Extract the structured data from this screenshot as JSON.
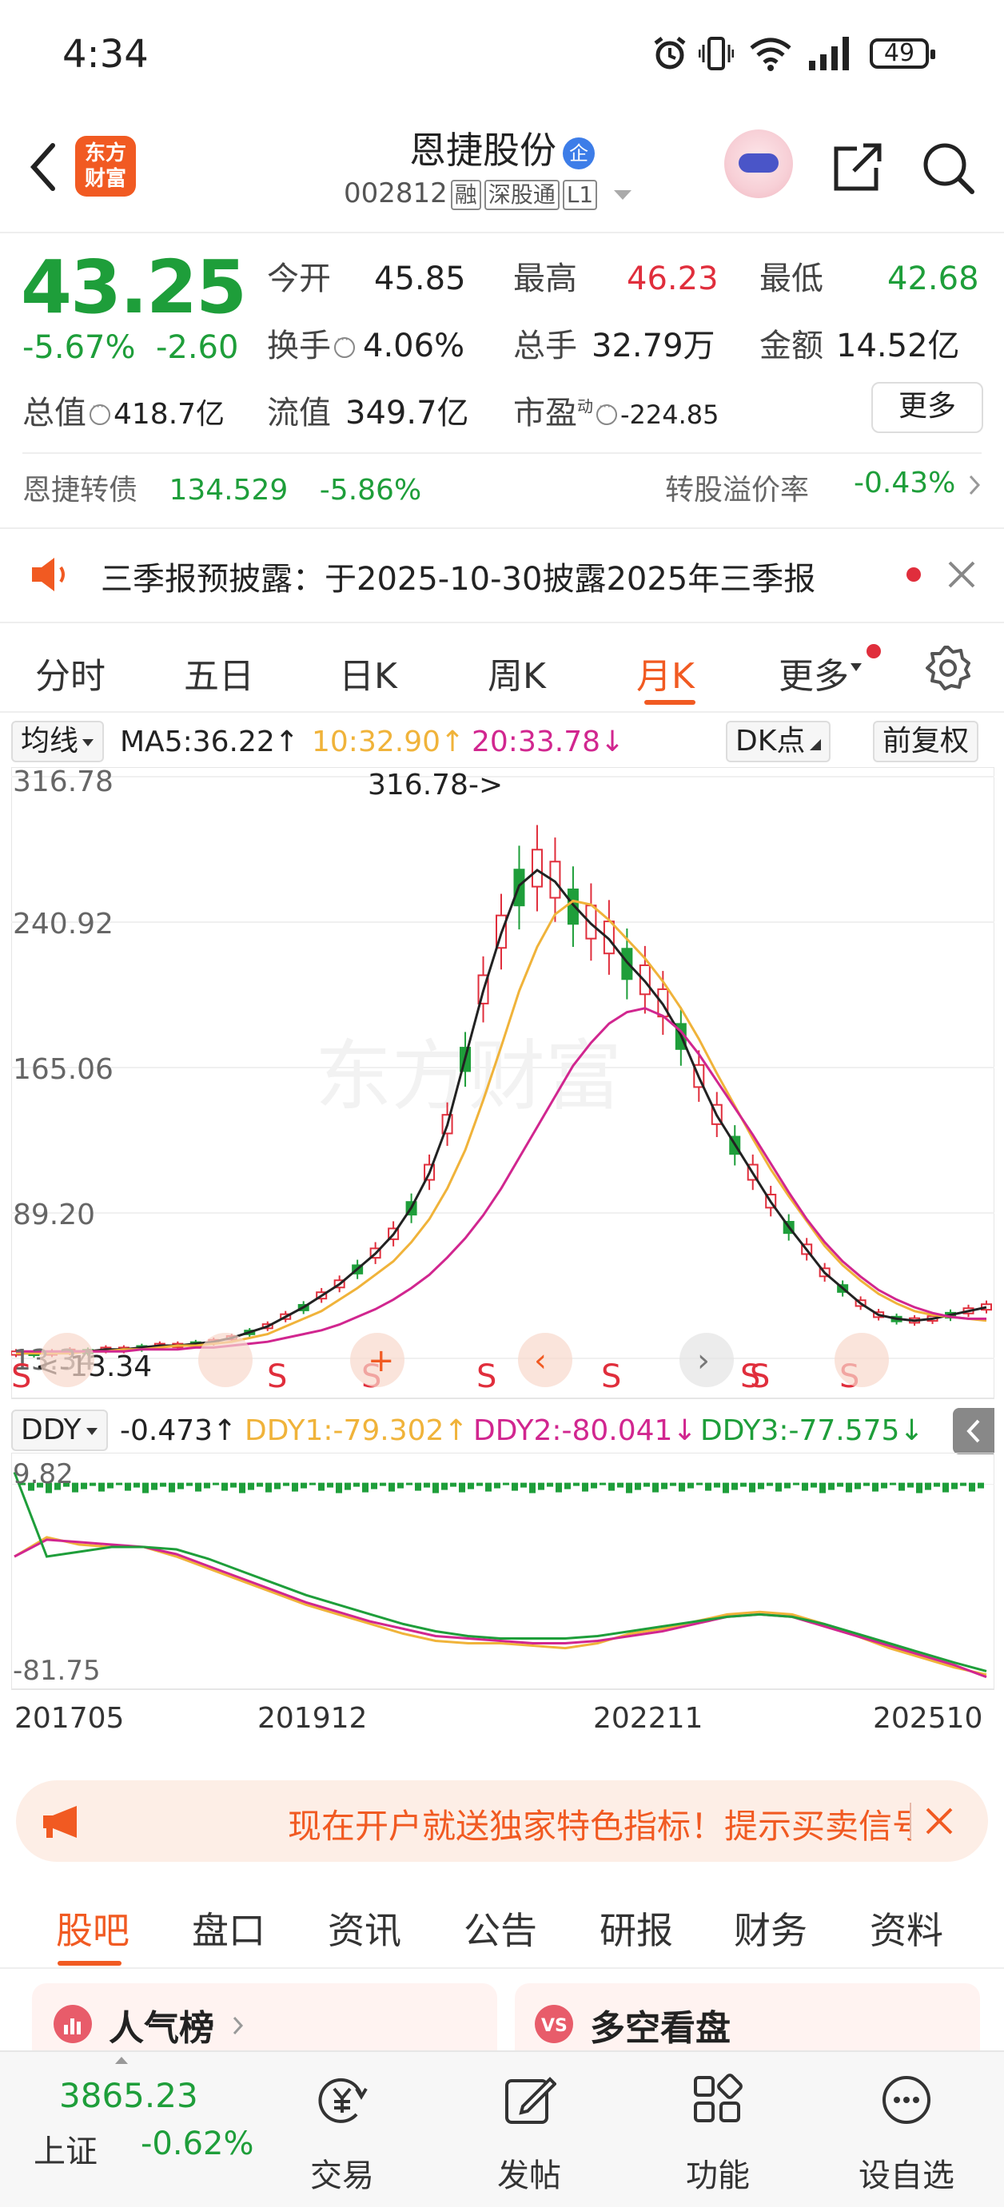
{
  "status_bar": {
    "time": "4:34",
    "battery": "49"
  },
  "header": {
    "logo_line1": "东方",
    "logo_line2": "财富",
    "stock_name": "恩捷股份",
    "badge": "企",
    "stock_code": "002812",
    "tags": [
      "融",
      "深股通",
      "L1"
    ]
  },
  "quote": {
    "price": "43.25",
    "change_pct": "-5.67%",
    "change_amt": "-2.60",
    "open_label": "今开",
    "open": "45.85",
    "high_label": "最高",
    "high": "46.23",
    "low_label": "最低",
    "low": "42.68",
    "turnover_label": "换手",
    "turnover": "4.06%",
    "volume_label": "总手",
    "volume": "32.79万",
    "amount_label": "金额",
    "amount": "14.52亿",
    "mktcap_label": "总值",
    "mktcap": "418.7亿",
    "float_label": "流值",
    "float": "349.7亿",
    "pe_label": "市盈",
    "pe_sup": "动",
    "pe": "-224.85",
    "more_label": "更多"
  },
  "bond": {
    "name": "恩捷转债",
    "price": "134.529",
    "change": "-5.86%",
    "premium_label": "转股溢价率",
    "premium": "-0.43%"
  },
  "notice": {
    "text": "三季报预披露：于2025-10-30披露2025年三季报"
  },
  "period_tabs": [
    "分时",
    "五日",
    "日K",
    "周K",
    "月K",
    "更多"
  ],
  "ma": {
    "selector": "均线",
    "ma5": "MA5:36.22",
    "ma10": "10:32.90",
    "ma20": "20:33.78",
    "dk_label": "DK点",
    "fq_label": "前复权",
    "colors": {
      "ma5": "#222222",
      "ma10": "#f0b33a",
      "ma20": "#d1268f"
    }
  },
  "ddy": {
    "selector": "DDY",
    "ddy": "-0.473",
    "ddy1": "DDY1:-79.302",
    "ddy2": "DDY2:-80.041",
    "ddy3": "DDY3:-77.575"
  },
  "chart_data": [
    {
      "type": "candlestick",
      "title": "",
      "y_ticks": [
        "316.78",
        "240.92",
        "165.06",
        "89.20",
        "13.34"
      ],
      "ylim": [
        13.34,
        316.78
      ],
      "high_marker": "316.78->",
      "low_marker": "<-13.34",
      "signal_marks": [
        "S",
        "S",
        "S",
        "S",
        "S",
        "S",
        "S",
        "S"
      ],
      "x_ticks": [
        "201705",
        "201912",
        "202211",
        "202510"
      ],
      "series": [
        {
          "name": "MA5",
          "values": [
            16,
            16,
            16,
            17,
            17,
            18,
            18,
            19,
            20,
            20,
            21,
            22,
            24,
            27,
            30,
            35,
            40,
            46,
            52,
            60,
            68,
            78,
            92,
            110,
            135,
            170,
            205,
            235,
            260,
            268,
            262,
            250,
            240,
            232,
            220,
            210,
            198,
            182,
            160,
            140,
            125,
            110,
            95,
            82,
            70,
            58,
            50,
            42,
            36,
            34,
            33,
            34,
            36,
            38,
            40
          ]
        },
        {
          "name": "MA10",
          "values": [
            16,
            16,
            16,
            16,
            17,
            17,
            18,
            18,
            19,
            20,
            20,
            21,
            22,
            24,
            26,
            30,
            34,
            38,
            44,
            50,
            57,
            64,
            74,
            86,
            102,
            122,
            148,
            176,
            205,
            228,
            245,
            252,
            250,
            242,
            232,
            222,
            210,
            196,
            180,
            162,
            145,
            128,
            112,
            98,
            85,
            72,
            62,
            54,
            47,
            42,
            38,
            36,
            35,
            34,
            33
          ]
        },
        {
          "name": "MA20",
          "values": [
            17,
            17,
            17,
            17,
            17,
            17,
            17,
            18,
            18,
            18,
            19,
            19,
            20,
            21,
            22,
            24,
            26,
            28,
            31,
            35,
            39,
            44,
            50,
            57,
            66,
            76,
            88,
            102,
            118,
            134,
            150,
            166,
            178,
            188,
            194,
            196,
            192,
            184,
            172,
            158,
            144,
            130,
            115,
            100,
            86,
            74,
            64,
            56,
            49,
            44,
            40,
            37,
            35,
            34,
            34
          ]
        }
      ]
    },
    {
      "type": "line",
      "title": "",
      "y_ticks": [
        "9.82",
        "-81.75"
      ],
      "ylim": [
        -81.75,
        9.82
      ],
      "series": [
        {
          "name": "DDY1",
          "values": [
            -30,
            -22,
            -25,
            -26,
            -26,
            -30,
            -35,
            -40,
            -45,
            -50,
            -54,
            -58,
            -62,
            -65,
            -66,
            -66,
            -67,
            -68,
            -66,
            -62,
            -60,
            -57,
            -54,
            -53,
            -54,
            -58,
            -63,
            -68,
            -72,
            -76,
            -79
          ]
        },
        {
          "name": "DDY2",
          "values": [
            -30,
            -23,
            -24,
            -25,
            -26,
            -29,
            -34,
            -39,
            -44,
            -49,
            -53,
            -57,
            -60,
            -63,
            -64,
            -65,
            -66,
            -66,
            -65,
            -63,
            -61,
            -58,
            -55,
            -54,
            -55,
            -59,
            -63,
            -67,
            -71,
            -75,
            -80
          ]
        },
        {
          "name": "DDY3",
          "values": [
            5,
            -30,
            -28,
            -26,
            -26,
            -27,
            -31,
            -36,
            -41,
            -46,
            -50,
            -54,
            -58,
            -61,
            -63,
            -64,
            -64,
            -64,
            -63,
            -61,
            -59,
            -57,
            -55,
            -54,
            -55,
            -58,
            -62,
            -66,
            -70,
            -74,
            -77.575
          ]
        }
      ]
    }
  ],
  "ad": {
    "text": "现在开户就送独家特色指标！提示买卖信号"
  },
  "content_tabs": [
    "股吧",
    "盘口",
    "资讯",
    "公告",
    "研报",
    "财务",
    "资料"
  ],
  "cards": [
    {
      "title": "人气榜"
    },
    {
      "title": "多空看盘"
    }
  ],
  "bottom_nav": {
    "index_value": "3865.23",
    "index_name": "上证",
    "index_change": "-0.62%",
    "items": [
      "交易",
      "发帖",
      "功能",
      "设自选"
    ]
  }
}
